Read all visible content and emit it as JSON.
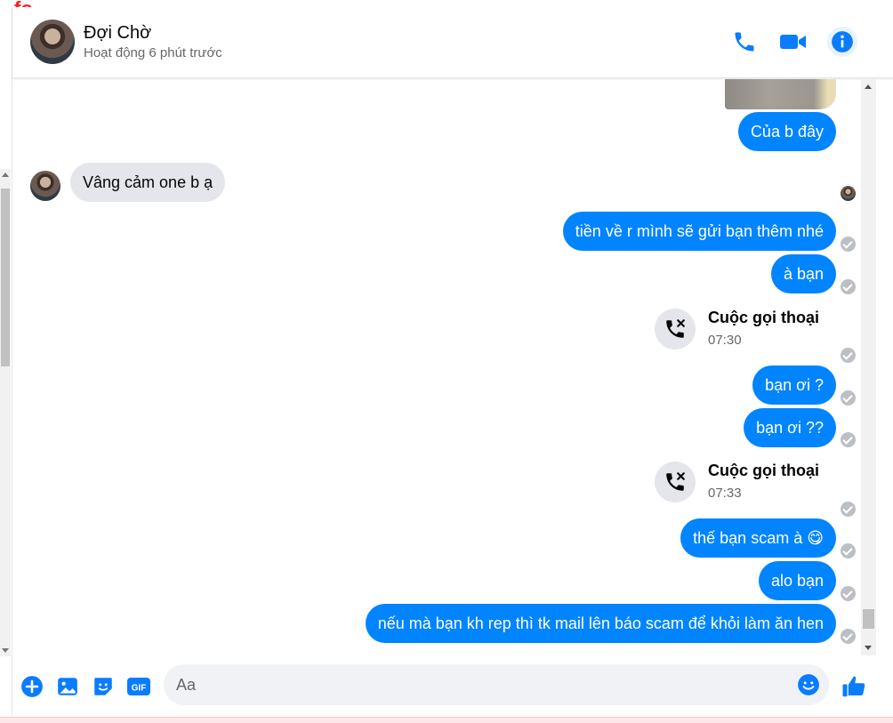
{
  "contact": {
    "name": "Đợi Chờ",
    "status": "Hoạt động 6 phút trước"
  },
  "header_icons": [
    "phone-icon",
    "video-camera-icon",
    "info-icon"
  ],
  "messages": {
    "out_1": "Của b đây",
    "in_1": "Vâng cảm one b ạ",
    "out_2": "tiền về r mình sẽ gửi bạn thêm nhé",
    "out_3": "à bạn",
    "call_1": {
      "title": "Cuộc gọi thoại",
      "time": "07:30"
    },
    "out_4": "bạn ơi ?",
    "out_5": "bạn ơi ??",
    "call_2": {
      "title": "Cuộc gọi thoại",
      "time": "07:33"
    },
    "out_6": "thế bạn scam à",
    "out_6_emoji": "😋",
    "out_7": "alo bạn",
    "out_8": "nếu mà bạn kh rep thì tk mail lên báo scam để khỏi làm ăn hen"
  },
  "composer": {
    "placeholder": "Aa",
    "gif_label": "GIF"
  },
  "colors": {
    "accent": "#0084ff",
    "incoming_bubble": "#e4e6eb",
    "icon_blue": "#0a7cff",
    "muted_text": "#65676b"
  }
}
